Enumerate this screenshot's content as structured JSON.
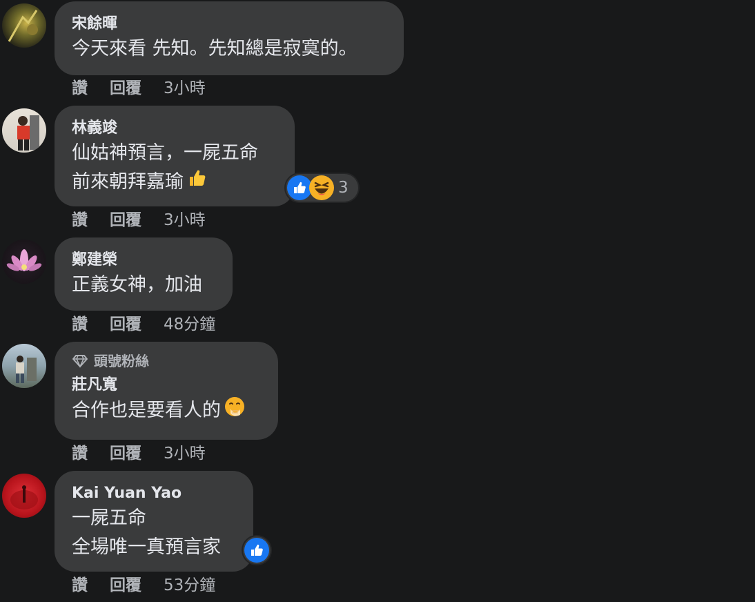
{
  "colors": {
    "background": "#18191a",
    "bubble": "#3a3b3c",
    "primary_text": "#e4e6eb",
    "secondary_text": "#b0b3b8",
    "like_blue": "#1877f2",
    "haha_yellow": "#f7b125"
  },
  "comments": [
    {
      "author": "宋餘暉",
      "lines": [
        "今天來看 先知。先知總是寂寞的。"
      ],
      "actions": {
        "like": "讚",
        "reply": "回覆",
        "time": "3小時"
      }
    },
    {
      "author": "林義竣",
      "lines": [
        "仙姑神預言，一屍五命",
        "前來朝拜嘉瑜"
      ],
      "emoji": "thumbs-up-emoji",
      "reactions": {
        "icons": [
          "like-icon",
          "haha-icon"
        ],
        "count": "3"
      },
      "actions": {
        "like": "讚",
        "reply": "回覆",
        "time": "3小時"
      }
    },
    {
      "author": "鄭建榮",
      "lines": [
        "正義女神，加油"
      ],
      "actions": {
        "like": "讚",
        "reply": "回覆",
        "time": "48分鐘"
      }
    },
    {
      "badge": "頭號粉絲",
      "author": "莊凡寬",
      "lines": [
        "合作也是要看人的"
      ],
      "emoji": "hand-over-mouth-emoji",
      "actions": {
        "like": "讚",
        "reply": "回覆",
        "time": "3小時"
      }
    },
    {
      "author": "Kai Yuan Yao",
      "lines": [
        "一屍五命",
        "全場唯一真預言家"
      ],
      "reactions": {
        "icons": [
          "like-icon"
        ],
        "count": ""
      },
      "actions": {
        "like": "讚",
        "reply": "回覆",
        "time": "53分鐘"
      }
    }
  ]
}
